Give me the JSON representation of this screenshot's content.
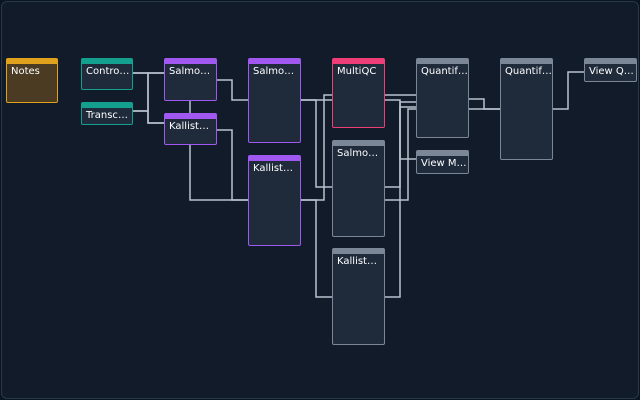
{
  "colors": {
    "background": "#111b2a",
    "edge": "#b9c3cf",
    "notes": "#e0a11c",
    "input": "#14a08e",
    "tool": "#a158f0",
    "report": "#ef3d78",
    "output": "#7b8696"
  },
  "nodes": {
    "notes": "Notes",
    "controls": "Control…",
    "transcripts": "Transcr…",
    "salmon_index": "Salmon …",
    "kallisto_index": "Kallist…",
    "salmon_quant": "Salmon …",
    "kallisto_quant": "Kallist…",
    "multiqc": "MultiQC",
    "salmon_out": "Salmon …",
    "kallisto_out": "Kallist…",
    "quant_1": "Quantif…",
    "view_multiqc": "View Mu…",
    "quant_2": "Quantif…",
    "view_quant": "View Qu…"
  }
}
